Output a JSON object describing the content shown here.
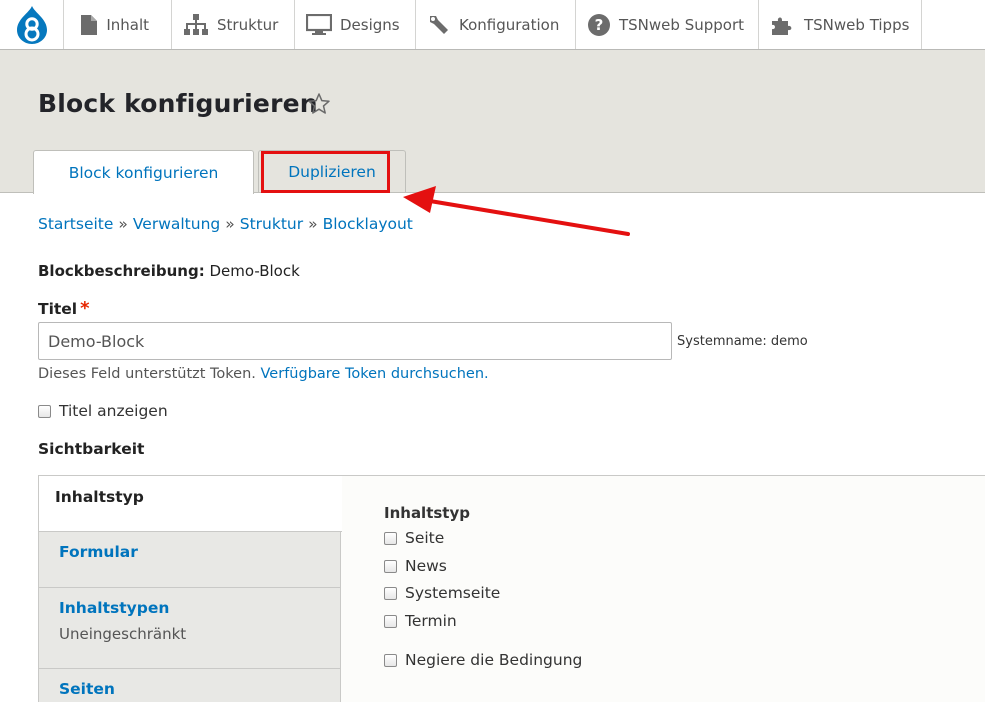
{
  "toolbar": {
    "logo_icon": "drupal-drop-icon",
    "items": [
      {
        "label": "Inhalt",
        "icon": "file-icon"
      },
      {
        "label": "Struktur",
        "icon": "sitemap-icon"
      },
      {
        "label": "Designs",
        "icon": "monitor-icon"
      },
      {
        "label": "Konfiguration",
        "icon": "wrench-icon"
      },
      {
        "label": "TSNweb Support",
        "icon": "question-circle-icon"
      },
      {
        "label": "TSNweb Tipps",
        "icon": "puzzle-icon"
      }
    ]
  },
  "header": {
    "title": "Block konfigurieren",
    "tabs": [
      {
        "label": "Block konfigurieren",
        "active": true
      },
      {
        "label": "Duplizieren",
        "active": false
      }
    ]
  },
  "annotation": {
    "color": "#e41010"
  },
  "breadcrumb": {
    "items": [
      "Startseite",
      "Verwaltung",
      "Struktur",
      "Blocklayout"
    ],
    "separator": "»"
  },
  "form": {
    "description_label": "Blockbeschreibung",
    "description_value": "Demo-Block",
    "title_label": "Titel",
    "required_marker": "*",
    "title_value": "Demo-Block",
    "machine_name": "Systemname: demo",
    "token_help_text": "Dieses Feld unterstützt Token.",
    "token_help_link": "Verfügbare Token durchsuchen.",
    "show_title_label": "Titel anzeigen",
    "visibility_heading": "Sichtbarkeit"
  },
  "vertical_tabs": {
    "items": [
      {
        "title": "Inhaltstyp",
        "summary": ""
      },
      {
        "title": "Formular",
        "summary": ""
      },
      {
        "title": "Inhaltstypen",
        "summary": "Uneingeschränkt"
      },
      {
        "title": "Seiten",
        "summary": ""
      }
    ],
    "pane": {
      "label": "Inhaltstyp",
      "options": [
        "Seite",
        "News",
        "Systemseite",
        "Termin"
      ],
      "negate_label": "Negiere die Bedingung"
    }
  },
  "colors": {
    "link": "#0074bd",
    "header_bg": "#e5e4de",
    "required": "#e62600",
    "drupal_blue": "#0678be"
  }
}
